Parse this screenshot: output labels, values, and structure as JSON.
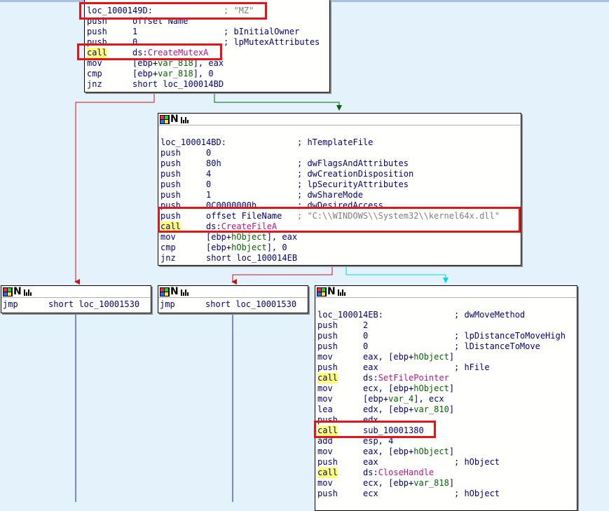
{
  "colors": {
    "background": "#e4f3fb",
    "edge_red": "#c81414",
    "edge_green": "#006400",
    "edge_cyan": "#00d2ff",
    "edge_blue": "#1414c8",
    "highlight_call": "#ffff73",
    "api_name": "#c0127e",
    "annotation_box": "#e4141b"
  },
  "header": {
    "icon": "graph-node-icon",
    "letter": "N"
  },
  "node_top": {
    "lines": [
      {
        "mn": "loc_1000149D:",
        "op": "",
        "cm": "; \"MZ\""
      },
      {
        "mn": "push",
        "op": "offset Name",
        "cm": ""
      },
      {
        "mn": "push",
        "op": "1",
        "cm": "; bInitialOwner"
      },
      {
        "mn": "push",
        "op": "0",
        "cm": "; lpMutexAttributes"
      },
      {
        "mn": "call",
        "op_pre": "ds:",
        "op_api": "CreateMutexA",
        "cm": ""
      },
      {
        "mn": "mov",
        "op_pre": "[ebp+",
        "op_var": "var_818",
        "op_post": "], eax",
        "cm": ""
      },
      {
        "mn": "cmp",
        "op_pre": "[ebp+",
        "op_var": "var_818",
        "op_post": "], 0",
        "cm": ""
      },
      {
        "mn": "jnz",
        "op": "short loc_100014BD",
        "cm": ""
      }
    ]
  },
  "node_mid": {
    "lines": [
      {
        "mn": "loc_100014BD:",
        "op": "",
        "cm": "; hTemplateFile"
      },
      {
        "mn": "push",
        "op": "0",
        "cm": ""
      },
      {
        "mn": "push",
        "op": "80h",
        "cm": "; dwFlagsAndAttributes"
      },
      {
        "mn": "push",
        "op": "4",
        "cm": "; dwCreationDisposition"
      },
      {
        "mn": "push",
        "op": "0",
        "cm": "; lpSecurityAttributes"
      },
      {
        "mn": "push",
        "op": "1",
        "cm": "; dwShareMode"
      },
      {
        "mn": "push",
        "op": "0C0000000h",
        "cm": "; dwDesiredAccess"
      },
      {
        "mn": "push",
        "op": "offset FileName",
        "cm": "; \"C:\\\\WINDOWS\\\\System32\\\\kernel64x.dll\""
      },
      {
        "mn": "call",
        "op_pre": "ds:",
        "op_api": "CreateFileA",
        "cm": ""
      },
      {
        "mn": "mov",
        "op_pre": "[ebp+",
        "op_var": "hObject",
        "op_post": "], eax",
        "cm": ""
      },
      {
        "mn": "cmp",
        "op_pre": "[ebp+",
        "op_var": "hObject",
        "op_post": "], 0",
        "cm": ""
      },
      {
        "mn": "jnz",
        "op": "short loc_100014EB",
        "cm": ""
      }
    ]
  },
  "node_left1": {
    "lines": [
      {
        "mn": "jmp",
        "op": "short loc_10001530"
      }
    ]
  },
  "node_left2": {
    "lines": [
      {
        "mn": "jmp",
        "op": "short loc_10001530"
      }
    ]
  },
  "node_right": {
    "lines": [
      {
        "mn": "loc_100014EB:",
        "op": "",
        "cm": "; dwMoveMethod"
      },
      {
        "mn": "push",
        "op": "2",
        "cm": ""
      },
      {
        "mn": "push",
        "op": "0",
        "cm": "; lpDistanceToMoveHigh"
      },
      {
        "mn": "push",
        "op": "0",
        "cm": "; lDistanceToMove"
      },
      {
        "mn": "mov",
        "op_pre": "eax, [ebp+",
        "op_var": "hObject",
        "op_post": "]",
        "cm": ""
      },
      {
        "mn": "push",
        "op": "eax",
        "cm": "; hFile"
      },
      {
        "mn": "call",
        "op_pre": "ds:",
        "op_api": "SetFilePointer",
        "cm": ""
      },
      {
        "mn": "mov",
        "op_pre": "ecx, [ebp+",
        "op_var": "hObject",
        "op_post": "]",
        "cm": ""
      },
      {
        "mn": "mov",
        "op_pre": "[ebp+",
        "op_var": "var_4",
        "op_post": "], ecx",
        "cm": ""
      },
      {
        "mn": "lea",
        "op_pre": "edx, [ebp+",
        "op_var": "var_810",
        "op_post": "]",
        "cm": ""
      },
      {
        "mn": "push",
        "op": "edx",
        "cm": ""
      },
      {
        "mn": "call",
        "op": "sub_10001380",
        "cm": ""
      },
      {
        "mn": "add",
        "op": "esp, 4",
        "cm": ""
      },
      {
        "mn": "mov",
        "op_pre": "eax, [ebp+",
        "op_var": "hObject",
        "op_post": "]",
        "cm": ""
      },
      {
        "mn": "push",
        "op": "eax",
        "cm": "; hObject"
      },
      {
        "mn": "call",
        "op_pre": "ds:",
        "op_api": "CloseHandle",
        "cm": ""
      },
      {
        "mn": "mov",
        "op_pre": "ecx, [ebp+",
        "op_var": "var_818",
        "op_post": "]",
        "cm": ""
      },
      {
        "mn": "push",
        "op": "ecx",
        "cm": "; hObject"
      }
    ]
  }
}
